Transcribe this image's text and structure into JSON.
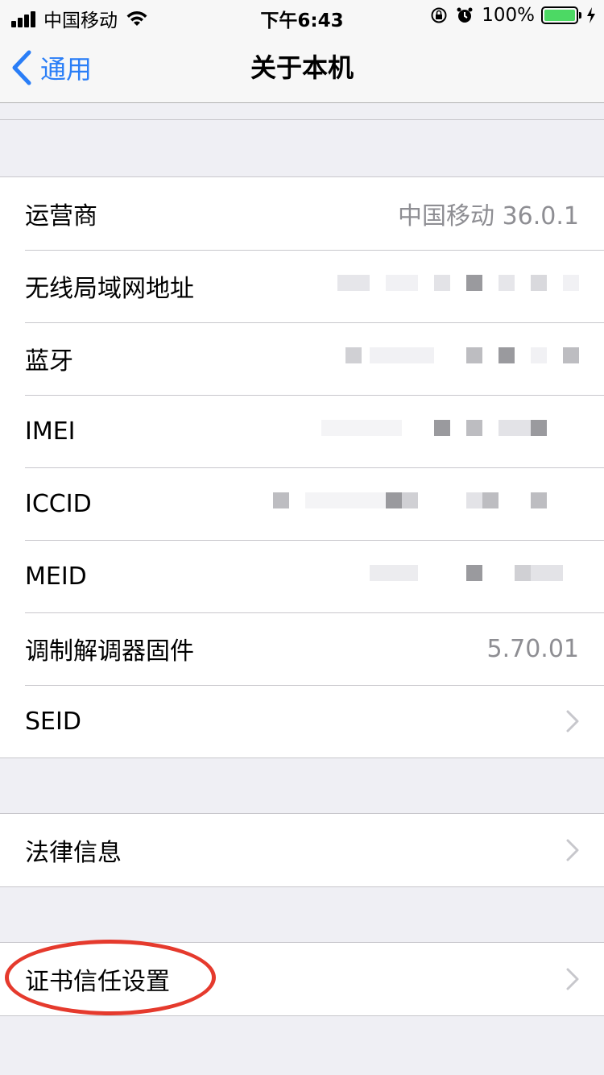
{
  "status_bar": {
    "carrier": "中国移动",
    "time": "下午6:43",
    "battery_percent": "100%",
    "icons": [
      "signal-icon",
      "wifi-icon",
      "rotation-lock-icon",
      "alarm-icon",
      "battery-icon",
      "charging-icon"
    ],
    "battery_fill": 1.0
  },
  "nav": {
    "back_label": "通用",
    "title": "关于本机"
  },
  "info_group": {
    "rows": [
      {
        "label": "运营商",
        "value": "中国移动 36.0.1"
      },
      {
        "label": "无线局域网地址",
        "value": ""
      },
      {
        "label": "蓝牙",
        "value": ""
      },
      {
        "label": "IMEI",
        "value": ""
      },
      {
        "label": "ICCID",
        "value": ""
      },
      {
        "label": "MEID",
        "value": ""
      },
      {
        "label": "调制解调器固件",
        "value": "5.70.01"
      },
      {
        "label": "SEID",
        "value": ""
      }
    ]
  },
  "legal_group": {
    "label": "法律信息"
  },
  "cert_group": {
    "label": "证书信任设置"
  },
  "colors": {
    "accent": "#2a7ef7",
    "background": "#efeff4",
    "highlight": "#e53a2d",
    "battery": "#4cd964"
  }
}
